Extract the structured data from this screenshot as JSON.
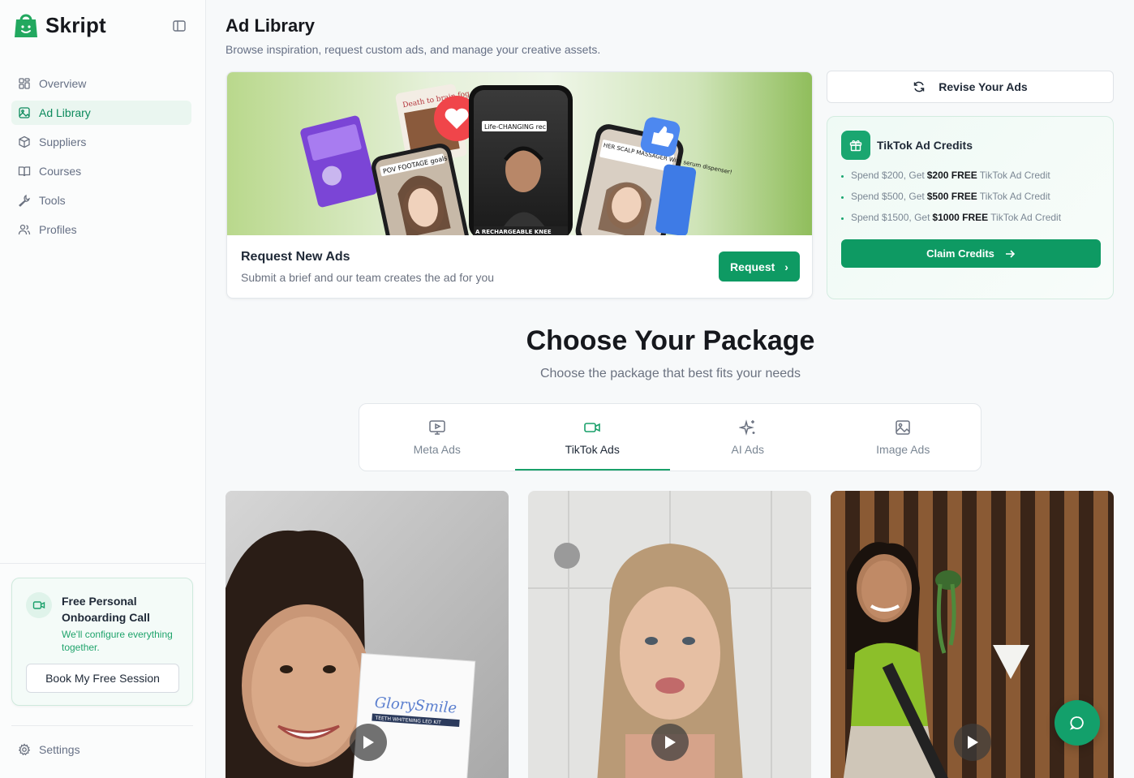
{
  "app": {
    "name": "Skript",
    "colors": {
      "accent": "#0e9a63",
      "accent_light": "#eaf6f0"
    }
  },
  "sidebar": {
    "items": [
      {
        "label": "Overview",
        "icon": "grid-icon",
        "active": false
      },
      {
        "label": "Ad Library",
        "icon": "image-icon",
        "active": true
      },
      {
        "label": "Suppliers",
        "icon": "box-icon",
        "active": false
      },
      {
        "label": "Courses",
        "icon": "book-icon",
        "active": false
      },
      {
        "label": "Tools",
        "icon": "wrench-icon",
        "active": false
      },
      {
        "label": "Profiles",
        "icon": "users-icon",
        "active": false
      }
    ],
    "onboarding": {
      "title": "Free Personal Onboarding Call",
      "subtitle": "We'll configure everything together.",
      "button": "Book My Free Session"
    },
    "settings_label": "Settings"
  },
  "header": {
    "title": "Ad Library",
    "subtitle": "Browse inspiration, request custom ads, and manage your creative assets."
  },
  "request_card": {
    "title": "Request New Ads",
    "subtitle": "Submit a brief and our team creates the ad for you",
    "button": "Request"
  },
  "revise": {
    "label": "Revise Your Ads"
  },
  "credits": {
    "title": "TikTok Ad Credits",
    "items": [
      {
        "pre": "Spend $200, Get",
        "bold": "$200 FREE",
        "post": "TikTok Ad Credit"
      },
      {
        "pre": "Spend $500, Get",
        "bold": "$500 FREE",
        "post": "TikTok Ad Credit"
      },
      {
        "pre": "Spend $1500, Get",
        "bold": "$1000 FREE",
        "post": "TikTok Ad Credit"
      }
    ],
    "button": "Claim Credits"
  },
  "packages": {
    "title": "Choose Your Package",
    "subtitle": "Choose the package that best fits your needs",
    "tabs": [
      {
        "label": "Meta Ads",
        "icon": "monitor-play-icon",
        "active": false
      },
      {
        "label": "TikTok Ads",
        "icon": "video-icon",
        "active": true
      },
      {
        "label": "AI Ads",
        "icon": "sparkles-icon",
        "active": false
      },
      {
        "label": "Image Ads",
        "icon": "image-icon",
        "active": false
      }
    ]
  },
  "banner_text": {
    "phone1": "POV FOOTAGE goals",
    "phone2": "Life-CHANGING rec",
    "phone3": "HER SCALP MASSAGER With serum dispenser!",
    "card": "Death to brain fog",
    "bottom": "A RECHARGEABLE KNEE"
  },
  "videos": [
    {
      "product_label": "GlorySmile",
      "product_sub": "TEETH WHITENING LED KIT"
    },
    {},
    {}
  ]
}
